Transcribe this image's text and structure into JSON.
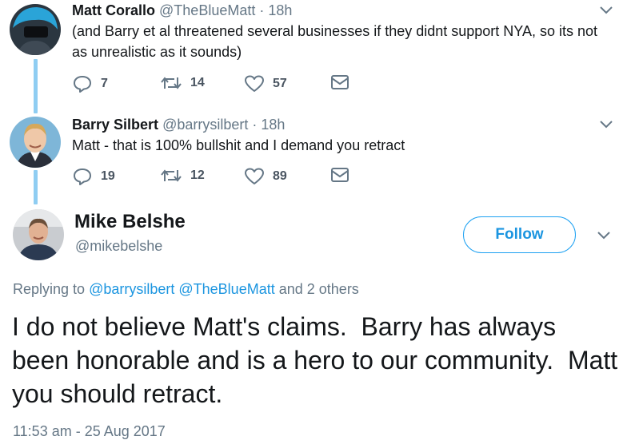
{
  "tweets": [
    {
      "name": "Matt Corallo",
      "handle": "@TheBlueMatt",
      "dot": "·",
      "time": "18h",
      "text": "(and Barry et al threatened several businesses if they didnt support NYA, so its not as unrealistic as it sounds)",
      "replies": "7",
      "retweets": "14",
      "likes": "57"
    },
    {
      "name": "Barry Silbert",
      "handle": "@barrysilbert",
      "dot": "·",
      "time": "18h",
      "text": "Matt - that is 100% bullshit and I demand you retract",
      "replies": "19",
      "retweets": "12",
      "likes": "89"
    }
  ],
  "focus": {
    "name": "Mike Belshe",
    "handle": "@mikebelshe",
    "follow_label": "Follow",
    "replying_prefix": "Replying to",
    "reply_to_1": "@barrysilbert",
    "reply_to_2": "@TheBlueMatt",
    "reply_suffix": "and 2 others",
    "text": "I do not believe Matt's claims.  Barry has always been honorable and is a hero to our community.  Matt you should retract.",
    "timestamp": "11:53 am - 25 Aug 2017"
  },
  "icons": [
    "reply-icon",
    "retweet-icon",
    "like-icon",
    "dm-icon",
    "chevron-down-icon"
  ],
  "colors": {
    "accent": "#1da1f2",
    "link": "#1b95e0",
    "muted": "#657786",
    "thread": "#8fcdf2"
  }
}
